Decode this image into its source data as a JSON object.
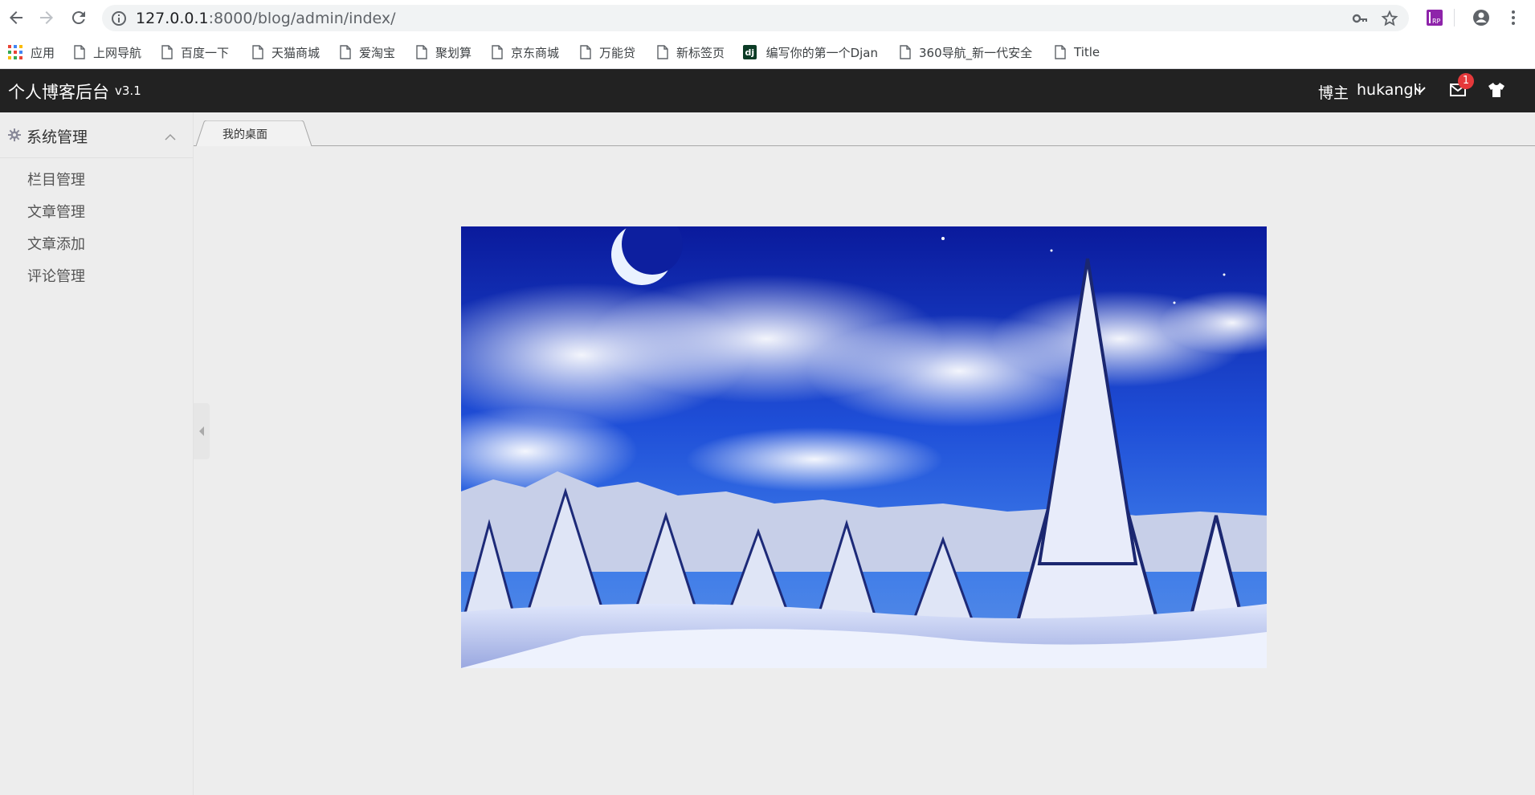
{
  "browser": {
    "url_host": "127.0.0.1",
    "url_rest": ":8000/blog/admin/index/"
  },
  "bookmarks": {
    "apps_label": "应用",
    "items": [
      {
        "label": "上网导航"
      },
      {
        "label": "百度一下"
      },
      {
        "label": "天猫商城"
      },
      {
        "label": "爱淘宝"
      },
      {
        "label": "聚划算"
      },
      {
        "label": "京东商城"
      },
      {
        "label": "万能贷"
      },
      {
        "label": "新标签页"
      },
      {
        "label": "编写你的第一个Djan",
        "icon_text": "dj"
      },
      {
        "label": "360导航_新一代安全"
      },
      {
        "label": "Title"
      }
    ]
  },
  "header": {
    "title": "个人博客后台",
    "version": "v3.1",
    "role": "博主",
    "username": "hukangli",
    "mail_badge": "1"
  },
  "sidebar": {
    "group_label": "系统管理",
    "items": [
      {
        "label": "栏目管理"
      },
      {
        "label": "文章管理"
      },
      {
        "label": "文章添加"
      },
      {
        "label": "评论管理"
      }
    ]
  },
  "tabs": [
    {
      "label": "我的桌面"
    }
  ],
  "icons": {
    "back": "arrow-left-icon",
    "forward": "arrow-right-icon",
    "reload": "reload-icon",
    "site_info": "info-icon",
    "key": "key-icon",
    "star": "star-icon",
    "extension": "rp-extension-icon",
    "profile": "account-icon",
    "menu": "kebab-menu-icon",
    "mail": "envelope-icon",
    "theme": "tshirt-icon",
    "settings": "gear-icon"
  },
  "colors": {
    "header_bg": "#222222",
    "page_bg": "#ededed",
    "badge": "#e5393b"
  }
}
